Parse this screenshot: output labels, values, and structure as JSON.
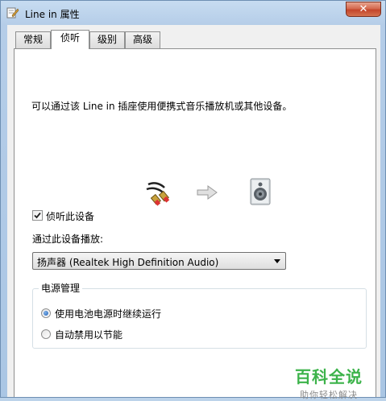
{
  "window": {
    "title": "Line in 属性",
    "close_glyph": "✕"
  },
  "tabs": [
    {
      "label": "常规",
      "active": false
    },
    {
      "label": "侦听",
      "active": true
    },
    {
      "label": "级别",
      "active": false
    },
    {
      "label": "高级",
      "active": false
    }
  ],
  "listen": {
    "description": "可以通过该 Line in 插座使用便携式音乐播放机或其他设备。",
    "listen_checkbox": {
      "label": "侦听此设备",
      "checked": true
    },
    "playback_label": "通过此设备播放:",
    "playback_device": "扬声器 (Realtek High Definition Audio)",
    "power": {
      "title": "电源管理",
      "options": [
        {
          "label": "使用电池电源时继续运行",
          "selected": true
        },
        {
          "label": "自动禁用以节能",
          "selected": false
        }
      ]
    }
  },
  "watermark": {
    "main": "百科全说",
    "sub": "助你轻松解决"
  },
  "icons": [
    "properties-app-icon",
    "audio-cable-icon",
    "arrow-right-icon",
    "speaker-icon",
    "checkmark-icon"
  ],
  "colors": {
    "accent_radio": "#2563b8",
    "watermark_green": "#3cb34a",
    "close_red": "#c4452b"
  }
}
